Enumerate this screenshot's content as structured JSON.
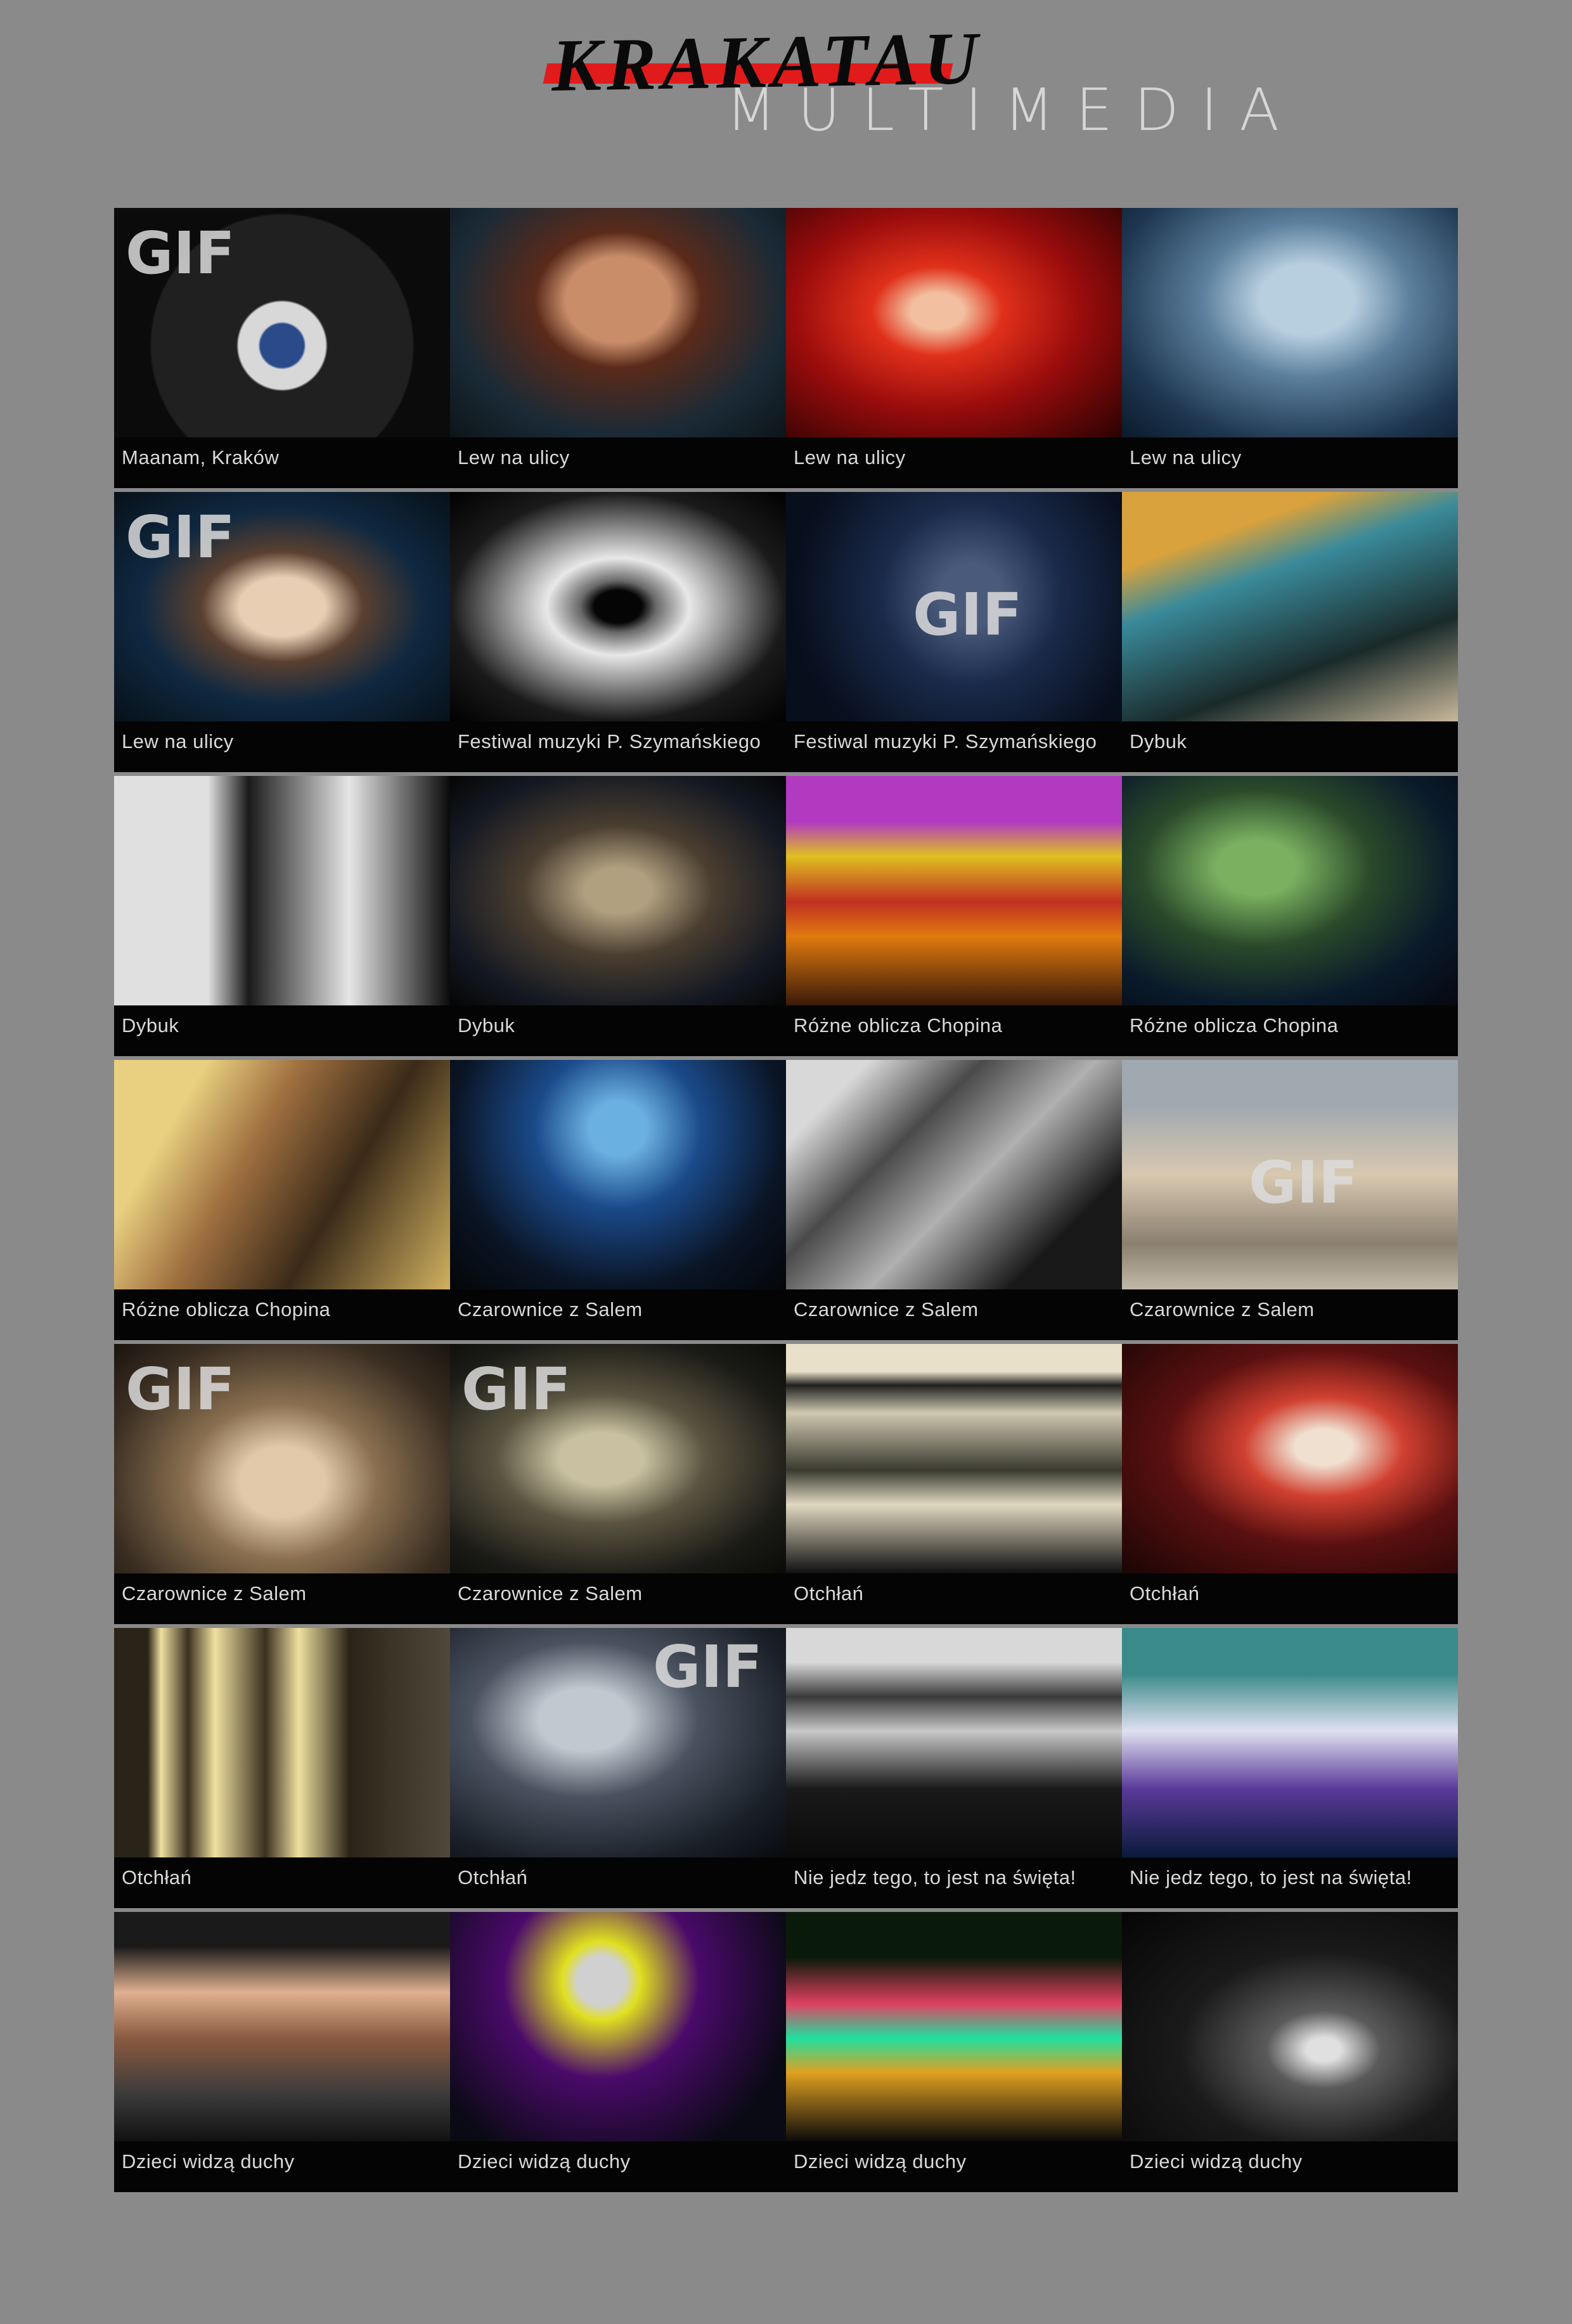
{
  "logo": {
    "brand": "KRAKATAU",
    "sub": "MULTIMEDIA"
  },
  "gif_label": "GIF",
  "rows": [
    {
      "tiles": [
        {
          "caption": "Maanam, Kraków",
          "gif": true,
          "bg": "radial-gradient(circle at 50% 60%, #2a4a8a 0 10%, #d8d8d8 11% 20%, #202020 21% 60%, #0b0b0b 61%)"
        },
        {
          "caption": "Lew na ulicy",
          "gif": false,
          "bg": "radial-gradient(ellipse at 50% 40%, #c98d6a 0 22%, #5a2a1a 35%, #1a2a36 70%, #0c1418)"
        },
        {
          "caption": "Lew na ulicy",
          "gif": false,
          "bg": "radial-gradient(ellipse at 45% 45%, #f2c0a0 0 10%, #e0301a 25%, #9a0c0c 55%, #2a0202)"
        },
        {
          "caption": "Lew na ulicy",
          "gif": false,
          "bg": "radial-gradient(ellipse at 55% 40%, #b8cfe0 0 18%, #5b7f9c 40%, #1e3650 75%, #0a1a2a)"
        }
      ]
    },
    {
      "tiles": [
        {
          "caption": "Lew na ulicy",
          "gif": true,
          "bg": "radial-gradient(ellipse at 50% 50%, #e8cfb4 0 18%, #5a4030 34%, #0f2840 60%, #071018)"
        },
        {
          "caption": "Festiwal muzyki P. Szymańskiego",
          "gif": false,
          "bg": "radial-gradient(ellipse at 50% 50%, #050505 0 10%, #6a6a6a 16%, #e8e8e8 30%, #1a1a1a 70%, #000)"
        },
        {
          "caption": "Festiwal muzyki P. Szymańskiego",
          "gif": true,
          "gifPos": "mid",
          "bg": "radial-gradient(circle at 55% 45%, #4a5a7a 0 14%, #1a2a4a 40%, #070e1c 80%)"
        },
        {
          "caption": "Dybuk",
          "gif": false,
          "bg": "linear-gradient(160deg, #d9a23c 0 22%, #3a8a9a 38%, #1a2a2a 70%, #c8b89a)"
        }
      ]
    },
    {
      "tiles": [
        {
          "caption": "Dybuk",
          "gif": false,
          "bg": "linear-gradient(90deg, #e0e0e0 0 28%, #1a1a1a 40%, #e6e6e6 70%, #0a0a0a)"
        },
        {
          "caption": "Dybuk",
          "gif": false,
          "bg": "radial-gradient(ellipse at 50% 50%, #b0a080 0 14%, #4a3e30 40%, #141822 75%, #050505)"
        },
        {
          "caption": "Różne oblicza Chopina",
          "gif": false,
          "bg": "linear-gradient(180deg, #b23ac0 0 20%, #e0c020 35%, #c03020 55%, #e07a10 70%, #3a1a08)"
        },
        {
          "caption": "Różne oblicza Chopina",
          "gif": false,
          "bg": "radial-gradient(ellipse at 40% 40%, #7ab060 0 14%, #2a4a2a 40%, #0a1a2a 70%, #050810)"
        }
      ]
    },
    {
      "tiles": [
        {
          "caption": "Różne oblicza Chopina",
          "gif": false,
          "bg": "linear-gradient(120deg, #e8d080 0 20%, #a07040 40%, #3a2a18 65%, #d0b060)"
        },
        {
          "caption": "Czarownice z Salem",
          "gif": false,
          "bg": "radial-gradient(ellipse at 50% 30%, #6ab0e0 0 12%, #1a4a8a 35%, #0a1424 70%, #040608)"
        },
        {
          "caption": "Czarownice z Salem",
          "gif": false,
          "bg": "linear-gradient(135deg, #d8d8d8 0 15%, #4a4a4a 35%, #b0b0b0 55%, #181818 80%)"
        },
        {
          "caption": "Czarownice z Salem",
          "gif": true,
          "gifPos": "mid",
          "bg": "linear-gradient(180deg, #a0a8b0 0 20%, #d8c8b0 50%, #8a8070 80%, #c0b8a8)"
        }
      ]
    },
    {
      "tiles": [
        {
          "caption": "Czarownice z Salem",
          "gif": true,
          "bg": "radial-gradient(ellipse at 50% 60%, #e0c8a8 0 18%, #8a7050 40%, #3a2e22 75%, #1a140e)"
        },
        {
          "caption": "Czarownice z Salem",
          "gif": true,
          "bg": "radial-gradient(ellipse at 45% 50%, #c8c0a0 0 16%, #5a5440 40%, #1a1a16 75%, #0a0a08)"
        },
        {
          "caption": "Otchłań",
          "gif": false,
          "bg": "linear-gradient(180deg, #e8e0c8 0 12%, #202020 18%, #d0c8b0 30%, #3a3a30 55%, #e0d8c0 70%, #101010)"
        },
        {
          "caption": "Otchłań",
          "gif": false,
          "bg": "radial-gradient(ellipse at 60% 45%, #f0e0d0 0 10%, #d04030 28%, #5a1010 55%, #1a0505)"
        }
      ]
    },
    {
      "tiles": [
        {
          "caption": "Otchłań",
          "gif": false,
          "bg": "linear-gradient(90deg, #2a2418 0 10%, #f0e0a0 14%, #3a3020 22%, #f0e0a0 30%, #3a3020 45%, #f0e0a0 55%, #2a2418 70%, #50483a)"
        },
        {
          "caption": "Otchłań",
          "gif": true,
          "gifPos": "right",
          "bg": "radial-gradient(ellipse at 40% 40%, #c0c8d0 0 16%, #4a5260 40%, #1a2028 75%, #080a0e)"
        },
        {
          "caption": "Nie jedz tego, to jest na święta!",
          "gif": false,
          "bg": "linear-gradient(180deg, #d8d8d8 0 15%, #3a3a3a 30%, #c8c8c8 45%, #1a1a1a 70%, #0a0a0a)"
        },
        {
          "caption": "Nie jedz tego, to jest na święta!",
          "gif": false,
          "bg": "linear-gradient(180deg, #3a8a8a 0 20%, #e0e0f0 45%, #5a3a9a 70%, #0a1a3a)"
        }
      ]
    },
    {
      "tiles": [
        {
          "caption": "Dzieci widzą duchy",
          "gif": false,
          "bg": "linear-gradient(180deg, #1a1a1a 0 15%, #e0b090 35%, #8a5a40 55%, #3a3a3a 80%, #111)"
        },
        {
          "caption": "Dzieci widzą duchy",
          "gif": false,
          "bg": "radial-gradient(circle at 45% 30%, #d0d0d0 0 10%, #e0e020 16%, #4a0a6a 40%, #0a0a14 80%)"
        },
        {
          "caption": "Dzieci widzą duchy",
          "gif": false,
          "bg": "linear-gradient(180deg, #0a1a0a 0 20%, #e04060 40%, #20e0a0 55%, #e0a020 70%, #0a0a0a)"
        },
        {
          "caption": "Dzieci widzą duchy",
          "gif": false,
          "bg": "radial-gradient(ellipse at 60% 60%, #e0e0e0 0 6%, #5a5a5a 20%, #1a1a1a 50%, #050505)"
        }
      ]
    }
  ]
}
